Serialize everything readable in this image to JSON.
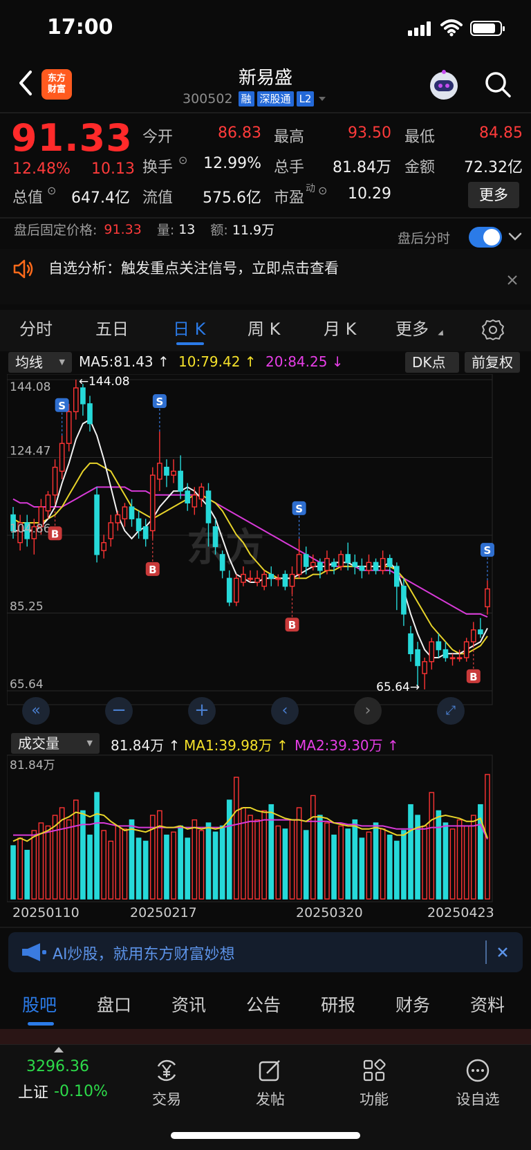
{
  "status": {
    "time": "17:00"
  },
  "header": {
    "logo_top": "东方",
    "logo_bottom": "财富",
    "name": "新易盛",
    "code": "300502",
    "tags": [
      "融",
      "深股通",
      "L2"
    ]
  },
  "quote": {
    "price": "91.33",
    "pct": "12.48%",
    "chg": "10.13",
    "open_lbl": "今开",
    "open": "86.83",
    "high_lbl": "最高",
    "high": "93.50",
    "low_lbl": "最低",
    "low": "84.85",
    "turnover_lbl": "换手",
    "turnover": "12.99%",
    "volume_lbl": "总手",
    "volume": "81.84万",
    "amount_lbl": "金额",
    "amount": "72.32亿",
    "mktcap_lbl": "总值",
    "mktcap": "647.4亿",
    "float_lbl": "流值",
    "float": "575.6亿",
    "pe_lbl": "市盈",
    "pe_sup": "动",
    "pe": "10.29",
    "more": "更多"
  },
  "after_hours": {
    "label": "盘后固定价格:",
    "price": "91.33",
    "vol_lbl": "量:",
    "vol": "13",
    "amt_lbl": "额:",
    "amt": "11.9万",
    "toggle_label": "盘后分时"
  },
  "notice": "自选分析：触发重点关注信号，立即点击查看",
  "tabs": [
    "分时",
    "五日",
    "日 K",
    "周 K",
    "月 K",
    "更多"
  ],
  "ma": {
    "select": "均线",
    "ma5": "MA5:81.43",
    "ma10": "10:79.42",
    "ma20": "20:84.25",
    "dk": "DK点",
    "adjust": "前复权"
  },
  "volume": {
    "select": "成交量",
    "vol": "81.84万",
    "ma1": "MA1:39.98万",
    "ma2": "MA2:39.30万",
    "top_label": "81.84万",
    "dates": [
      "20250110",
      "20250217",
      "20250320",
      "20250423"
    ]
  },
  "chart_data": {
    "type": "candlestick",
    "y_ticks": [
      "144.08",
      "124.47",
      "104.86",
      "85.25",
      "65.64"
    ],
    "ylim": [
      65.64,
      144.08
    ],
    "max_label": "144.08",
    "min_label": "65.64",
    "signals": {
      "buy": "B",
      "sell": "S"
    },
    "candles": [
      [
        110,
        106,
        112,
        104
      ],
      [
        103,
        108,
        110,
        101
      ],
      [
        108,
        104,
        110,
        102
      ],
      [
        104,
        107,
        109,
        100
      ],
      [
        107,
        112,
        114,
        105
      ],
      [
        111,
        115,
        116,
        109
      ],
      [
        115,
        122,
        124,
        113
      ],
      [
        121,
        128,
        130,
        119
      ],
      [
        128,
        136,
        138,
        126
      ],
      [
        136,
        142,
        144.08,
        134
      ],
      [
        142,
        138,
        143,
        135
      ],
      [
        138,
        133,
        140,
        131
      ],
      [
        115,
        100,
        117,
        98
      ],
      [
        101,
        103,
        105,
        99
      ],
      [
        104,
        108,
        110,
        102
      ],
      [
        108,
        110,
        111,
        106
      ],
      [
        109,
        112,
        113,
        107
      ],
      [
        112,
        109,
        114,
        107
      ],
      [
        109,
        106,
        111,
        104
      ],
      [
        107,
        104,
        109,
        102
      ],
      [
        106,
        120,
        122,
        104
      ],
      [
        119,
        123,
        131,
        116
      ],
      [
        122,
        120,
        124,
        117
      ],
      [
        120,
        121,
        124,
        118
      ],
      [
        121,
        116,
        125,
        114
      ],
      [
        116,
        113,
        118,
        111
      ],
      [
        112,
        115,
        117,
        110
      ],
      [
        114,
        117,
        118,
        112
      ],
      [
        116,
        108,
        118,
        102
      ],
      [
        107,
        102,
        109,
        100
      ],
      [
        100,
        96,
        101,
        94
      ],
      [
        94,
        88,
        96,
        87
      ],
      [
        88,
        94,
        95,
        87
      ],
      [
        93,
        95,
        97,
        92
      ],
      [
        94,
        94,
        96,
        93
      ],
      [
        93,
        94,
        96,
        92
      ],
      [
        92,
        95,
        96,
        91
      ],
      [
        95,
        94,
        97,
        92
      ],
      [
        94,
        94,
        95,
        92
      ],
      [
        95,
        92,
        96,
        91
      ],
      [
        92,
        95,
        97,
        90
      ],
      [
        95,
        100,
        104,
        94
      ],
      [
        100,
        97,
        102,
        95
      ],
      [
        97,
        98,
        100,
        96
      ],
      [
        98,
        96,
        99,
        94
      ],
      [
        96,
        99,
        101,
        95
      ],
      [
        98,
        97,
        99,
        95
      ],
      [
        97,
        100,
        101,
        96
      ],
      [
        100,
        98,
        103,
        96
      ],
      [
        98,
        97,
        100,
        95
      ],
      [
        97,
        96,
        99,
        94
      ],
      [
        96,
        98,
        100,
        95
      ],
      [
        98,
        96,
        99,
        95
      ],
      [
        96,
        99,
        101,
        95
      ],
      [
        99,
        97,
        100,
        95
      ],
      [
        97,
        92,
        98,
        86
      ],
      [
        92,
        85,
        94,
        82
      ],
      [
        80,
        75,
        82,
        73
      ],
      [
        76,
        72,
        78,
        67
      ],
      [
        70,
        73,
        74,
        66
      ],
      [
        73,
        78,
        79,
        71
      ],
      [
        78,
        76,
        80,
        74
      ],
      [
        76,
        74,
        78,
        73
      ],
      [
        74,
        74,
        75,
        72
      ],
      [
        74,
        74,
        76,
        73
      ],
      [
        74,
        78,
        79,
        73
      ],
      [
        78,
        81,
        83,
        77
      ],
      [
        81,
        80,
        84,
        79
      ],
      [
        86.83,
        91.33,
        93.5,
        84.85
      ]
    ],
    "ma5": [
      106,
      106,
      106,
      106,
      107,
      109,
      112,
      118,
      123,
      129,
      133,
      134,
      130,
      124,
      117,
      110,
      106,
      104,
      106,
      107,
      109,
      112,
      114,
      116,
      116,
      117,
      116,
      114,
      112,
      109,
      104,
      99,
      95,
      94,
      93,
      93,
      94,
      94,
      94,
      94,
      94,
      95,
      96,
      97,
      97,
      97,
      98,
      98,
      98,
      97,
      97,
      97,
      97,
      97,
      98,
      96,
      91,
      85,
      80,
      76,
      74,
      74,
      75,
      75,
      75,
      76,
      77,
      78,
      81.43
    ],
    "ma10": [
      109,
      108,
      108,
      108,
      108,
      109,
      110,
      112,
      115,
      118,
      121,
      123,
      123,
      122,
      121,
      118,
      115,
      112,
      111,
      110,
      109,
      110,
      111,
      112,
      113,
      114,
      115,
      115,
      114,
      113,
      111,
      108,
      105,
      103,
      100,
      98,
      96,
      95,
      94,
      94,
      94,
      94,
      94,
      95,
      95,
      96,
      96,
      97,
      97,
      97,
      97,
      97,
      97,
      97,
      97,
      96,
      94,
      91,
      88,
      85,
      82,
      80,
      78,
      76,
      75,
      75,
      76,
      77,
      79.42
    ],
    "ma20": [
      114,
      113,
      113,
      112,
      112,
      112,
      112,
      112,
      113,
      114,
      115,
      116,
      117,
      117,
      117,
      117,
      117,
      116,
      116,
      116,
      115,
      115,
      115,
      115,
      115,
      115,
      115,
      115,
      114,
      113,
      112,
      111,
      110,
      109,
      108,
      107,
      106,
      105,
      104,
      103,
      102,
      101,
      100,
      99,
      98,
      98,
      97,
      97,
      97,
      97,
      96,
      96,
      96,
      96,
      96,
      95,
      94,
      93,
      92,
      91,
      90,
      89,
      88,
      87,
      86,
      85,
      85,
      85,
      84.25
    ],
    "volumes": [
      35,
      40,
      32,
      45,
      50,
      48,
      55,
      60,
      52,
      65,
      58,
      42,
      70,
      45,
      38,
      48,
      46,
      52,
      40,
      38,
      55,
      58,
      42,
      44,
      48,
      40,
      52,
      45,
      50,
      44,
      48,
      65,
      80,
      60,
      55,
      52,
      58,
      62,
      48,
      46,
      52,
      60,
      45,
      68,
      55,
      50,
      42,
      48,
      46,
      52,
      40,
      44,
      50,
      46,
      42,
      38,
      45,
      62,
      55,
      48,
      70,
      58,
      50,
      46,
      52,
      48,
      55,
      62,
      81.84
    ],
    "vol_ma1": [
      38,
      40,
      38,
      41,
      43,
      45,
      48,
      52,
      54,
      57,
      56,
      54,
      56,
      55,
      51,
      48,
      45,
      46,
      45,
      44,
      46,
      48,
      47,
      47,
      48,
      46,
      47,
      46,
      47,
      46,
      47,
      52,
      58,
      60,
      60,
      58,
      57,
      57,
      55,
      53,
      52,
      52,
      51,
      54,
      54,
      53,
      50,
      49,
      48,
      48,
      46,
      46,
      47,
      46,
      44,
      42,
      42,
      45,
      47,
      48,
      52,
      54,
      55,
      54,
      53,
      51,
      51,
      53,
      39.98
    ],
    "vol_ma2": [
      42,
      42,
      42,
      42,
      43,
      44,
      45,
      46,
      47,
      48,
      49,
      49,
      50,
      50,
      49,
      48,
      48,
      48,
      47,
      47,
      47,
      47,
      47,
      47,
      47,
      47,
      47,
      47,
      47,
      47,
      47,
      48,
      49,
      50,
      51,
      51,
      52,
      52,
      52,
      52,
      52,
      52,
      51,
      51,
      51,
      51,
      50,
      50,
      49,
      49,
      48,
      48,
      48,
      48,
      47,
      46,
      46,
      46,
      46,
      46,
      47,
      47,
      48,
      48,
      48,
      48,
      48,
      49,
      39.3
    ]
  },
  "ai_bar": "AI炒股，就用东方财富妙想",
  "bottom_tabs": [
    "股吧",
    "盘口",
    "资讯",
    "公告",
    "研报",
    "财务",
    "资料"
  ],
  "index": {
    "value": "3296.36",
    "name": "上证",
    "pct": "-0.10%"
  },
  "nav": [
    "交易",
    "发帖",
    "功能",
    "设自选"
  ]
}
